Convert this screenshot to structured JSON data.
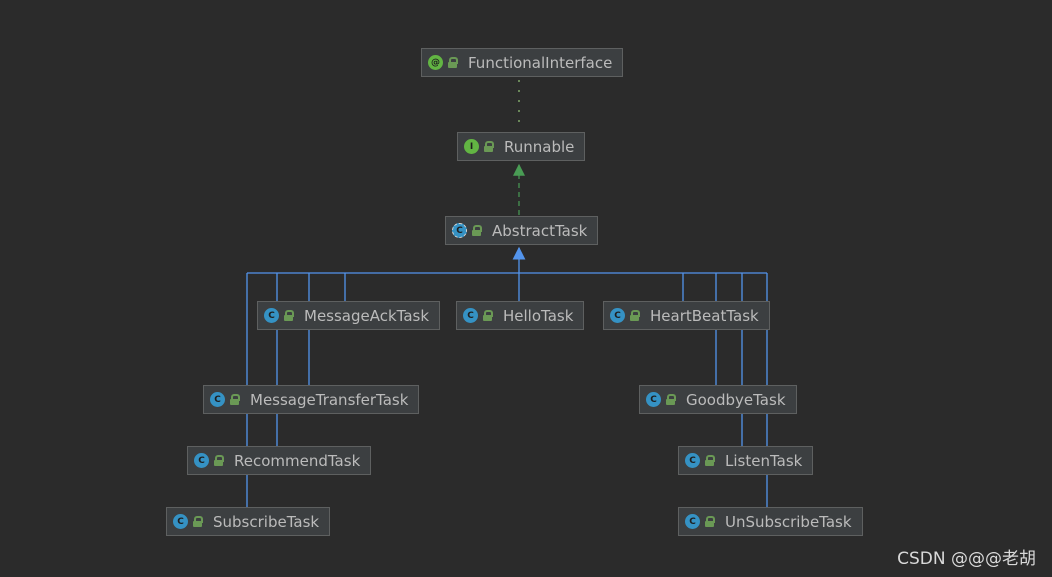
{
  "nodes": [
    {
      "id": "FunctionalInterface",
      "label": "FunctionalInterface",
      "kind": "annotation",
      "icon": "annotation-icon",
      "glyph": "@"
    },
    {
      "id": "Runnable",
      "label": "Runnable",
      "kind": "interface",
      "icon": "interface-icon",
      "glyph": "I"
    },
    {
      "id": "AbstractTask",
      "label": "AbstractTask",
      "kind": "abstract",
      "icon": "abstract-class-icon",
      "glyph": "C"
    },
    {
      "id": "MessageAckTask",
      "label": "MessageAckTask",
      "kind": "class",
      "icon": "class-icon",
      "glyph": "C"
    },
    {
      "id": "HelloTask",
      "label": "HelloTask",
      "kind": "class",
      "icon": "class-icon",
      "glyph": "C"
    },
    {
      "id": "HeartBeatTask",
      "label": "HeartBeatTask",
      "kind": "class",
      "icon": "class-icon",
      "glyph": "C"
    },
    {
      "id": "MessageTransferTask",
      "label": "MessageTransferTask",
      "kind": "class",
      "icon": "class-icon",
      "glyph": "C"
    },
    {
      "id": "GoodbyeTask",
      "label": "GoodbyeTask",
      "kind": "class",
      "icon": "class-icon",
      "glyph": "C"
    },
    {
      "id": "RecommendTask",
      "label": "RecommendTask",
      "kind": "class",
      "icon": "class-icon",
      "glyph": "C"
    },
    {
      "id": "ListenTask",
      "label": "ListenTask",
      "kind": "class",
      "icon": "class-icon",
      "glyph": "C"
    },
    {
      "id": "SubscribeTask",
      "label": "SubscribeTask",
      "kind": "class",
      "icon": "class-icon",
      "glyph": "C"
    },
    {
      "id": "UnSubscribeTask",
      "label": "UnSubscribeTask",
      "kind": "class",
      "icon": "class-icon",
      "glyph": "C"
    }
  ],
  "edges": [
    {
      "from": "Runnable",
      "to": "FunctionalInterface",
      "type": "annotated-by",
      "style": "dotted-green"
    },
    {
      "from": "AbstractTask",
      "to": "Runnable",
      "type": "implements",
      "style": "dashed-green"
    },
    {
      "from": "MessageAckTask",
      "to": "AbstractTask",
      "type": "extends",
      "style": "solid-blue"
    },
    {
      "from": "HelloTask",
      "to": "AbstractTask",
      "type": "extends",
      "style": "solid-blue"
    },
    {
      "from": "HeartBeatTask",
      "to": "AbstractTask",
      "type": "extends",
      "style": "solid-blue"
    },
    {
      "from": "MessageTransferTask",
      "to": "AbstractTask",
      "type": "extends",
      "style": "solid-blue"
    },
    {
      "from": "GoodbyeTask",
      "to": "AbstractTask",
      "type": "extends",
      "style": "solid-blue"
    },
    {
      "from": "RecommendTask",
      "to": "AbstractTask",
      "type": "extends",
      "style": "solid-blue"
    },
    {
      "from": "ListenTask",
      "to": "AbstractTask",
      "type": "extends",
      "style": "solid-blue"
    },
    {
      "from": "SubscribeTask",
      "to": "AbstractTask",
      "type": "extends",
      "style": "solid-blue"
    },
    {
      "from": "UnSubscribeTask",
      "to": "AbstractTask",
      "type": "extends",
      "style": "solid-blue"
    }
  ],
  "colors": {
    "background": "#2b2b2b",
    "node_fill": "#3c3f41",
    "node_border": "#5e6060",
    "text": "#bbbbbb",
    "class_icon": "#3592c4",
    "interface_icon": "#62b543",
    "lock_icon": "#6a9955",
    "extends_edge": "#5394ec",
    "implements_edge": "#499c54",
    "annotation_edge": "#6a8759"
  },
  "watermark": "CSDN @@@老胡"
}
